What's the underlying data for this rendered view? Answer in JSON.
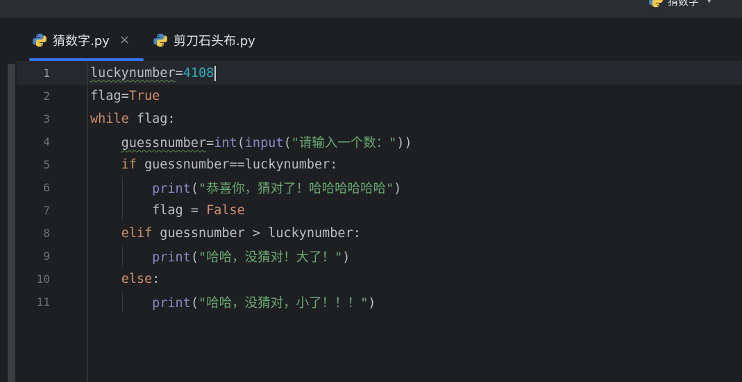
{
  "run_config": {
    "label": "猜数字",
    "icon": "python-icon"
  },
  "tabs": [
    {
      "label": "猜数字.py",
      "active": true,
      "close": "×",
      "icon": "python-file-icon"
    },
    {
      "label": "剪刀石头布.py",
      "active": false,
      "icon": "python-file-icon"
    }
  ],
  "editor": {
    "current_line": 1,
    "lines": [
      {
        "n": "1",
        "tokens": [
          [
            "luckynumber",
            "plain squig"
          ],
          [
            "=",
            "plain"
          ],
          [
            "4108",
            "num"
          ]
        ]
      },
      {
        "n": "2",
        "tokens": [
          [
            "flag",
            "plain"
          ],
          [
            "=",
            "plain"
          ],
          [
            "True",
            "kw"
          ]
        ]
      },
      {
        "n": "3",
        "tokens": [
          [
            "while",
            "kw"
          ],
          [
            " flag:",
            "plain"
          ]
        ]
      },
      {
        "n": "4",
        "tokens": [
          [
            "    ",
            "plain"
          ],
          [
            "guessnumber",
            "plain squig"
          ],
          [
            "=",
            "plain"
          ],
          [
            "int",
            "bi"
          ],
          [
            "(",
            "plain"
          ],
          [
            "input",
            "bi"
          ],
          [
            "(",
            "plain"
          ],
          [
            "\"请输入一个数：\"",
            "str"
          ],
          [
            "))",
            "plain"
          ]
        ]
      },
      {
        "n": "5",
        "tokens": [
          [
            "    ",
            "plain"
          ],
          [
            "if",
            "kw"
          ],
          [
            " guessnumber==luckynumber:",
            "plain"
          ]
        ]
      },
      {
        "n": "6",
        "tokens": [
          [
            "        ",
            "plain"
          ],
          [
            "print",
            "bi"
          ],
          [
            "(",
            "plain"
          ],
          [
            "\"恭喜你，猜对了！哈哈哈哈哈哈\"",
            "str"
          ],
          [
            ")",
            "plain"
          ]
        ]
      },
      {
        "n": "7",
        "tokens": [
          [
            "        flag = ",
            "plain"
          ],
          [
            "False",
            "kw"
          ]
        ]
      },
      {
        "n": "8",
        "tokens": [
          [
            "    ",
            "plain"
          ],
          [
            "elif",
            "kw"
          ],
          [
            " guessnumber > luckynumber:",
            "plain"
          ]
        ]
      },
      {
        "n": "9",
        "tokens": [
          [
            "        ",
            "plain"
          ],
          [
            "print",
            "bi"
          ],
          [
            "(",
            "plain"
          ],
          [
            "\"哈哈，没猜对！大了！\"",
            "str"
          ],
          [
            ")",
            "plain"
          ]
        ]
      },
      {
        "n": "10",
        "tokens": [
          [
            "    ",
            "plain"
          ],
          [
            "else",
            "kw"
          ],
          [
            ":",
            "plain"
          ]
        ]
      },
      {
        "n": "11",
        "tokens": [
          [
            "        ",
            "plain"
          ],
          [
            "print",
            "bi"
          ],
          [
            "(",
            "plain"
          ],
          [
            "\"哈哈，没猜对，小了！！！\"",
            "str"
          ],
          [
            ")",
            "plain"
          ]
        ]
      }
    ]
  },
  "colors": {
    "background": "#1e1f22",
    "keyword": "#cf8e6d",
    "number": "#2aacb8",
    "string": "#6aab73",
    "builtin": "#8888c6",
    "accent": "#3574f0"
  }
}
